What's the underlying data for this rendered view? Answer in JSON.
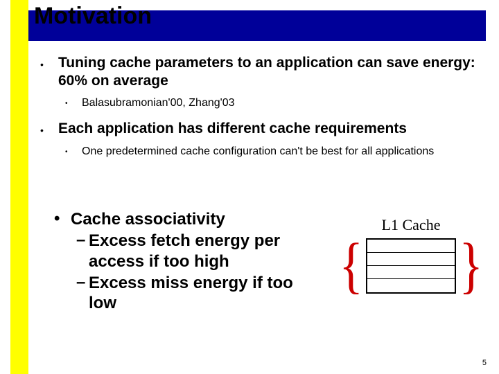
{
  "title": "Motivation",
  "bullets": {
    "b1": "Tuning cache parameters to an application can save energy: 60% on average",
    "b1_sub": "Balasubramonian'00, Zhang'03",
    "b2": "Each application has different cache requirements",
    "b2_sub": "One predetermined cache configuration can't be best for all applications"
  },
  "lower": {
    "heading": "Cache associativity",
    "d1": "Excess fetch energy per access if too high",
    "d2": "Excess miss energy if too low"
  },
  "cache": {
    "label": "L1 Cache",
    "left_brace": "{",
    "right_brace": "}"
  },
  "slide_number": "5"
}
